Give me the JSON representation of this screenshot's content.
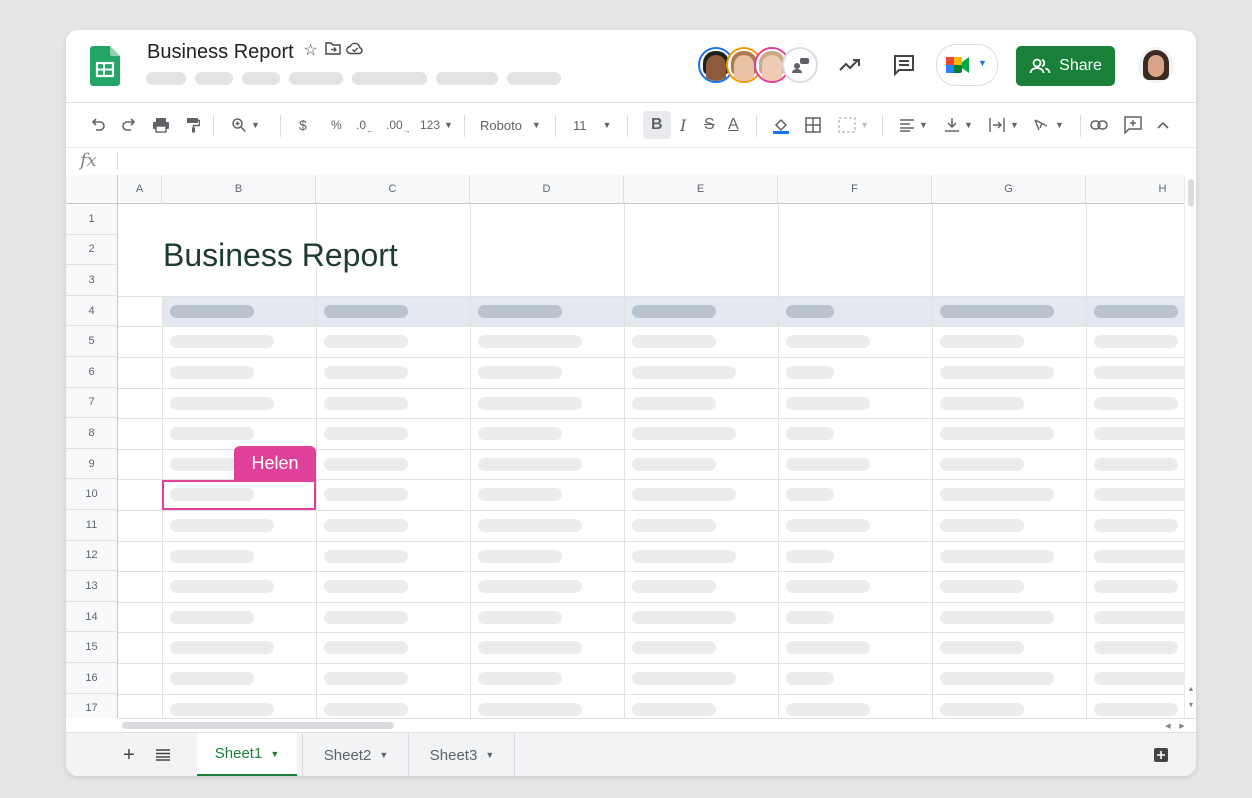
{
  "colors": {
    "brand_green": "#188038",
    "collaborator_pink": "#e0409a",
    "header_band": "#e4e9f1",
    "title_text": "#1e3a35"
  },
  "header": {
    "title": "Business Report",
    "title_icons": [
      "star-icon",
      "move-to-folder-icon",
      "cloud-saved-icon"
    ],
    "collaborators": [
      "avatar-1",
      "avatar-2",
      "avatar-3"
    ],
    "actions": [
      "activity-trend-icon",
      "comments-icon",
      "meet-icon"
    ],
    "share_label": "Share"
  },
  "toolbar": {
    "format_number": "123",
    "font_family": "Roboto",
    "font_size": "11"
  },
  "formula_bar": {
    "fx": "fx"
  },
  "grid": {
    "columns": [
      "A",
      "B",
      "C",
      "D",
      "E",
      "F",
      "G",
      "H"
    ],
    "rows": [
      "1",
      "2",
      "3",
      "4",
      "5",
      "6",
      "7",
      "8",
      "9",
      "10",
      "11",
      "12",
      "13",
      "14",
      "15",
      "16",
      "17"
    ],
    "sheet_heading": "Business Report",
    "collaborator_cursor": {
      "name": "Helen",
      "cell": "B10"
    }
  },
  "sheets": {
    "tabs": [
      {
        "label": "Sheet1",
        "active": true
      },
      {
        "label": "Sheet2",
        "active": false
      },
      {
        "label": "Sheet3",
        "active": false
      }
    ]
  }
}
